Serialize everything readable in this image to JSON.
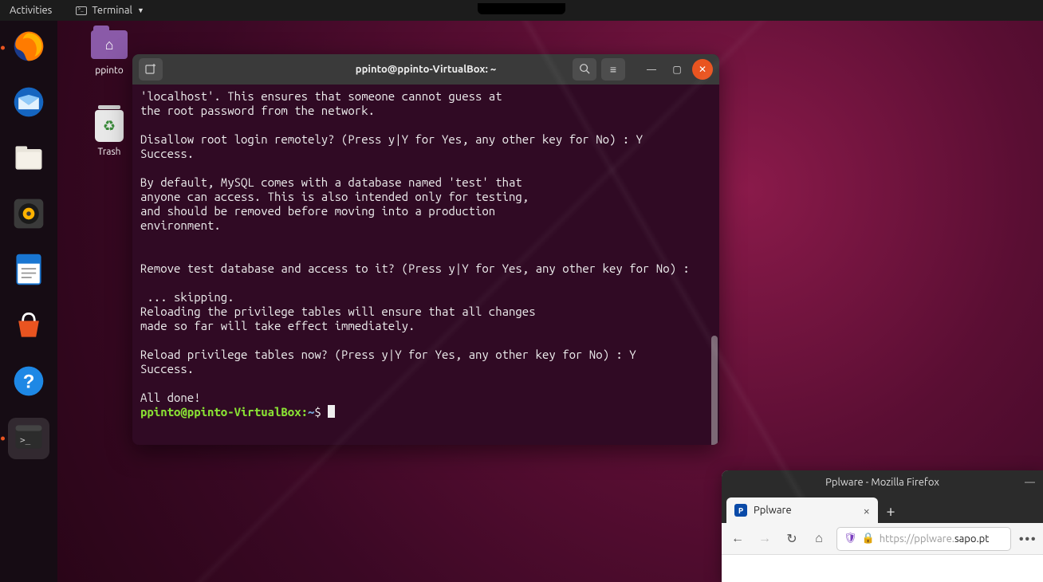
{
  "topbar": {
    "activities": "Activities",
    "appmenu_label": "Terminal"
  },
  "dock": {
    "items": [
      {
        "name": "firefox",
        "running": true
      },
      {
        "name": "thunderbird"
      },
      {
        "name": "files"
      },
      {
        "name": "rhythmbox"
      },
      {
        "name": "libreoffice-writer"
      },
      {
        "name": "software"
      },
      {
        "name": "help"
      },
      {
        "name": "terminal",
        "active": true
      }
    ]
  },
  "desktop_icons": {
    "home": {
      "label": "ppinto"
    },
    "trash": {
      "label": "Trash"
    }
  },
  "terminal": {
    "title": "ppinto@ppinto-VirtualBox: ~",
    "lines": [
      "'localhost'. This ensures that someone cannot guess at",
      "the root password from the network.",
      "",
      "Disallow root login remotely? (Press y|Y for Yes, any other key for No) : Y",
      "Success.",
      "",
      "By default, MySQL comes with a database named 'test' that",
      "anyone can access. This is also intended only for testing,",
      "and should be removed before moving into a production",
      "environment.",
      "",
      "",
      "Remove test database and access to it? (Press y|Y for Yes, any other key for No) :",
      "",
      " ... skipping.",
      "Reloading the privilege tables will ensure that all changes",
      "made so far will take effect immediately.",
      "",
      "Reload privilege tables now? (Press y|Y for Yes, any other key for No) : Y",
      "Success.",
      "",
      "All done!"
    ],
    "prompt_user": "ppinto@ppinto-VirtualBox",
    "prompt_path": "~",
    "prompt_symbol": "$"
  },
  "firefox": {
    "window_title": "Pplware - Mozilla Firefox",
    "tab_label": "Pplware",
    "favicon_letter": "P",
    "url_prefix": "https://pplware.",
    "url_main": "sapo.pt"
  }
}
